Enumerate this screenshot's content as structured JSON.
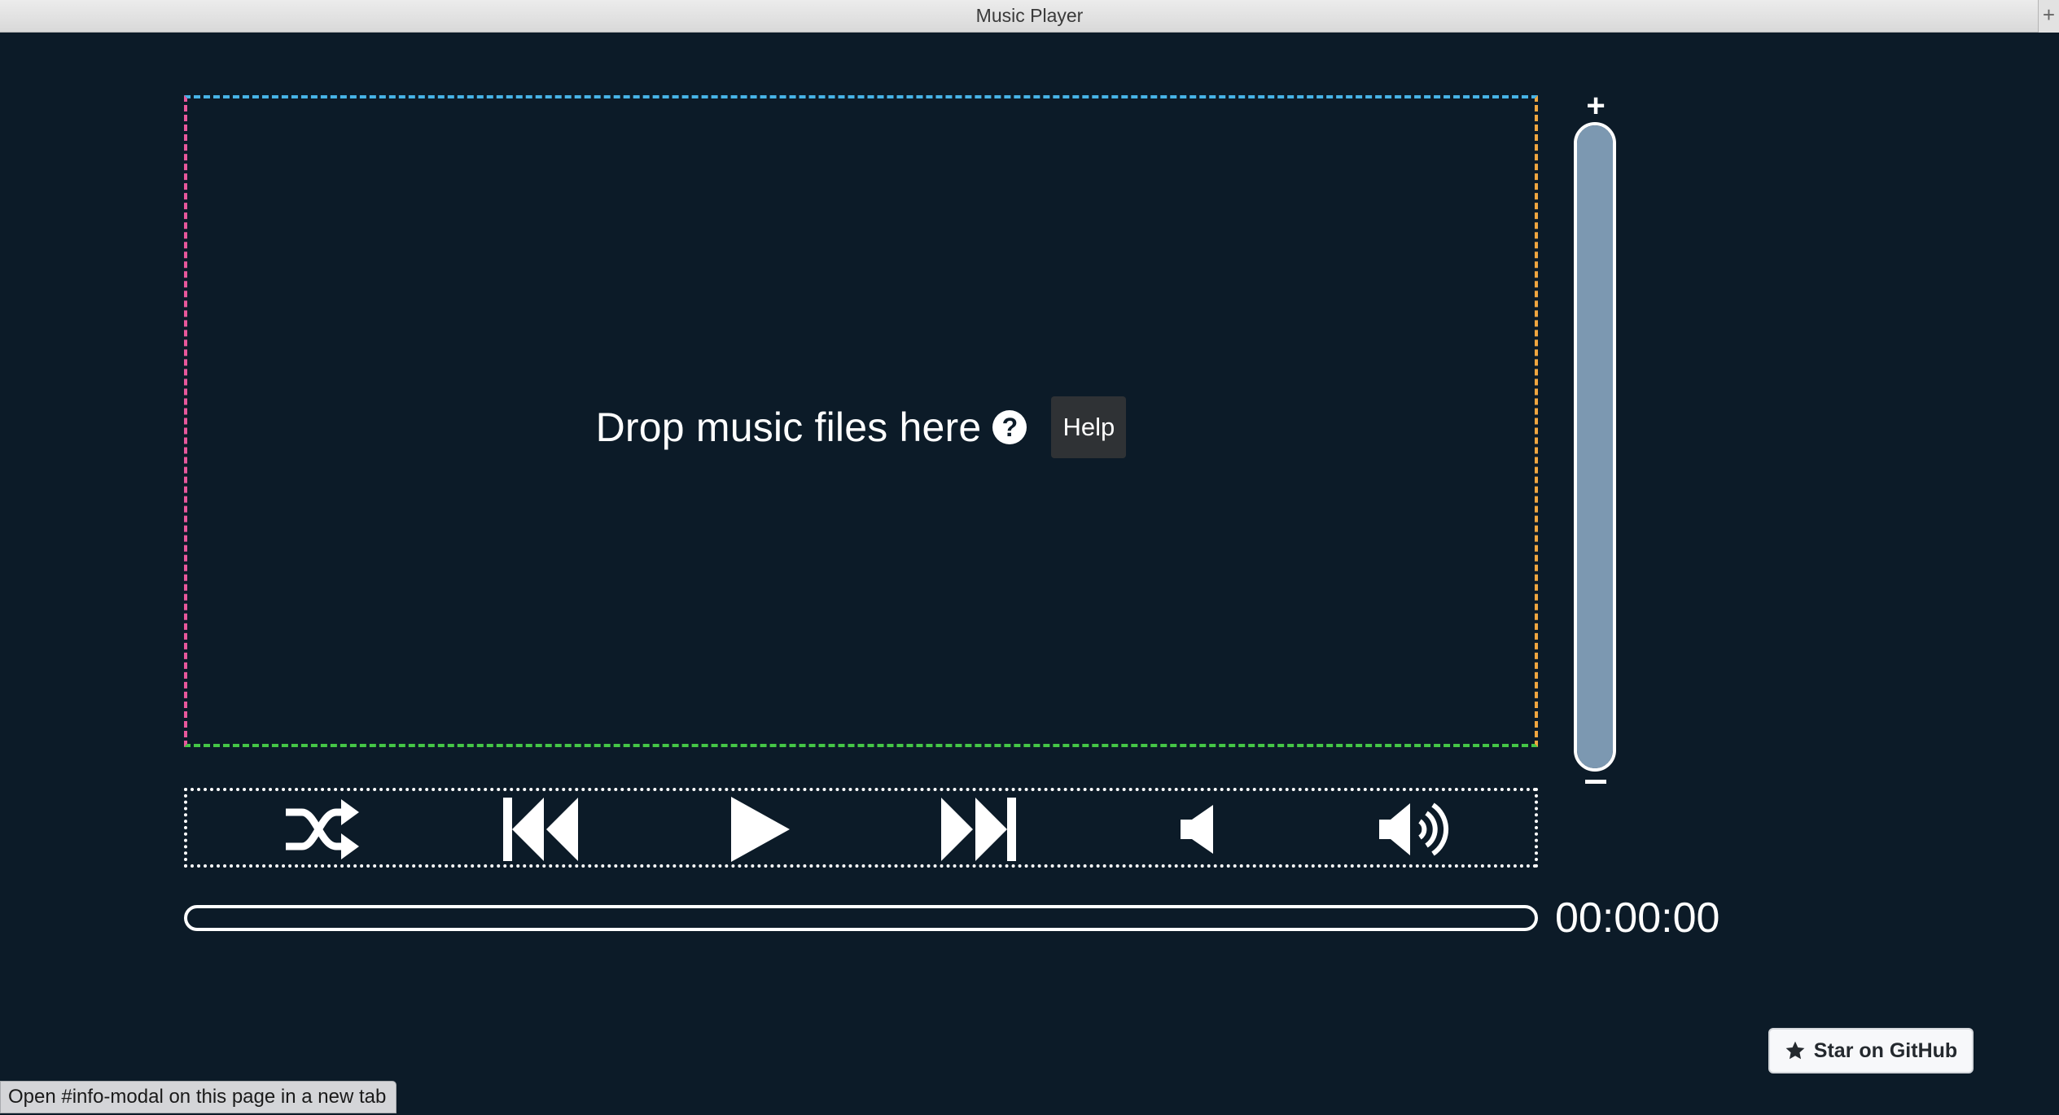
{
  "window": {
    "title": "Music Player",
    "new_tab_glyph": "+"
  },
  "dropzone": {
    "text": "Drop music files here",
    "help_icon_glyph": "?",
    "help_button_label": "Help",
    "border_colors": {
      "top": "#47b3e6",
      "left": "#e8589c",
      "right": "#f0a640",
      "bottom": "#45c646"
    }
  },
  "volume": {
    "plus_glyph": "+",
    "level": 1.0,
    "fill_color": "#7c98b1"
  },
  "controls": [
    {
      "name": "shuffle-button",
      "icon": "shuffle-icon"
    },
    {
      "name": "previous-button",
      "icon": "skip-back-icon"
    },
    {
      "name": "play-button",
      "icon": "play-icon"
    },
    {
      "name": "next-button",
      "icon": "skip-forward-icon"
    },
    {
      "name": "volume-down-button",
      "icon": "volume-low-icon"
    },
    {
      "name": "volume-up-button",
      "icon": "volume-high-icon"
    }
  ],
  "progress": {
    "value": 0.0,
    "time_display": "00:00:00"
  },
  "github": {
    "label": "Star on GitHub",
    "icon": "star-icon"
  },
  "status_bar": {
    "text": "Open #info-modal on this page in a new tab"
  },
  "colors": {
    "background": "#0c1b28",
    "foreground": "#ffffff",
    "help_button_bg": "#2f3235"
  }
}
